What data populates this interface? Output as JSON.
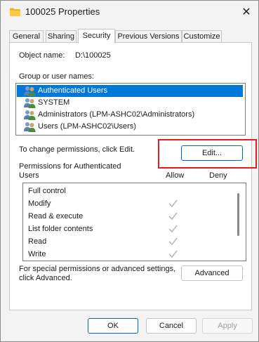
{
  "window": {
    "title": "100025 Properties",
    "close_label": "✕"
  },
  "tabs": [
    {
      "label": "General",
      "active": false
    },
    {
      "label": "Sharing",
      "active": false
    },
    {
      "label": "Security",
      "active": true
    },
    {
      "label": "Previous Versions",
      "active": false
    },
    {
      "label": "Customize",
      "active": false
    }
  ],
  "security": {
    "object_name_label": "Object name:",
    "object_name_value": "D:\\100025",
    "group_label": "Group or user names:",
    "groups": [
      {
        "label": "Authenticated Users",
        "selected": true
      },
      {
        "label": "SYSTEM",
        "selected": false
      },
      {
        "label": "Administrators (LPM-ASHC02\\Administrators)",
        "selected": false
      },
      {
        "label": "Users (LPM-ASHC02\\Users)",
        "selected": false
      }
    ],
    "change_hint": "To change permissions, click Edit.",
    "edit_button": "Edit...",
    "permissions_for_line1": "Permissions for Authenticated",
    "permissions_for_line2": "Users",
    "allow_header": "Allow",
    "deny_header": "Deny",
    "permissions": [
      {
        "name": "Full control",
        "allow": false,
        "deny": false
      },
      {
        "name": "Modify",
        "allow": true,
        "deny": false
      },
      {
        "name": "Read & execute",
        "allow": true,
        "deny": false
      },
      {
        "name": "List folder contents",
        "allow": true,
        "deny": false
      },
      {
        "name": "Read",
        "allow": true,
        "deny": false
      },
      {
        "name": "Write",
        "allow": true,
        "deny": false
      }
    ],
    "advanced_hint_line1": "For special permissions or advanced settings,",
    "advanced_hint_line2": "click Advanced.",
    "advanced_button": "Advanced"
  },
  "footer": {
    "ok": "OK",
    "cancel": "Cancel",
    "apply": "Apply"
  },
  "colors": {
    "selection": "#0078d7",
    "highlight": "#e11d1d",
    "check": "#b9b9b9"
  }
}
